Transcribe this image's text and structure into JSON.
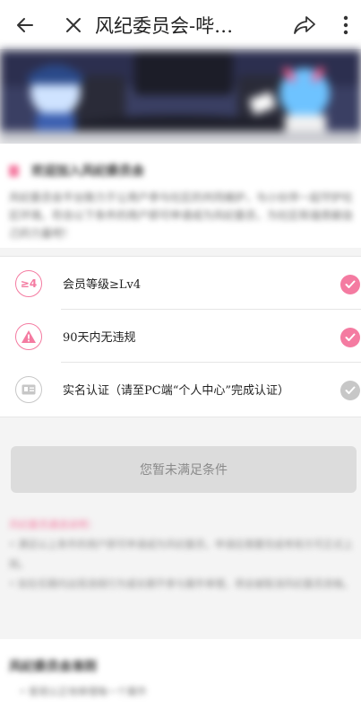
{
  "topbar": {
    "title": "风纪委员会-哔…",
    "back_icon": "arrow-left-icon",
    "close_icon": "close-icon",
    "share_icon": "share-icon",
    "more_icon": "more-vertical-icon"
  },
  "banner": {
    "image": "anime-mascots-meeting-room-banner"
  },
  "intro": {
    "heading": "欢迎加入风纪委员会",
    "body": "风纪委员会平台致力于让用户参与社区的共同维护，与小伙伴一起守护社区环境。符合以下条件的用户即可申请成为风纪委员，为社区和谐贡献自己的力量吧！"
  },
  "requirements": [
    {
      "badge": "≥4",
      "label": "会员等级≥Lv4",
      "met": true
    },
    {
      "badge": "!",
      "label": "90天内无违规",
      "met": true
    },
    {
      "badge": "id-card",
      "label": "实名认证（请至PC端“个人中心”完成认证）",
      "met": false
    }
  ],
  "cta": {
    "label": "您暂未满足条件"
  },
  "notes": {
    "title": "风纪委员遴选说明：",
    "lines": [
      "• 满足以上条件的用户即可申请成为风纪委员，申请后需要完成考核方可正式上岗。",
      "• 如在任期内出现违规行为或长期不参与案件审理，将会被取消风纪委员资格。"
    ]
  },
  "rules": {
    "heading": "风纪委员会准则",
    "first_line": "• 客观公正地审理每一个案件"
  },
  "colors": {
    "accent": "#f47ba1",
    "inactive": "#c7c7c7",
    "button_bg": "#dcdcdc"
  }
}
